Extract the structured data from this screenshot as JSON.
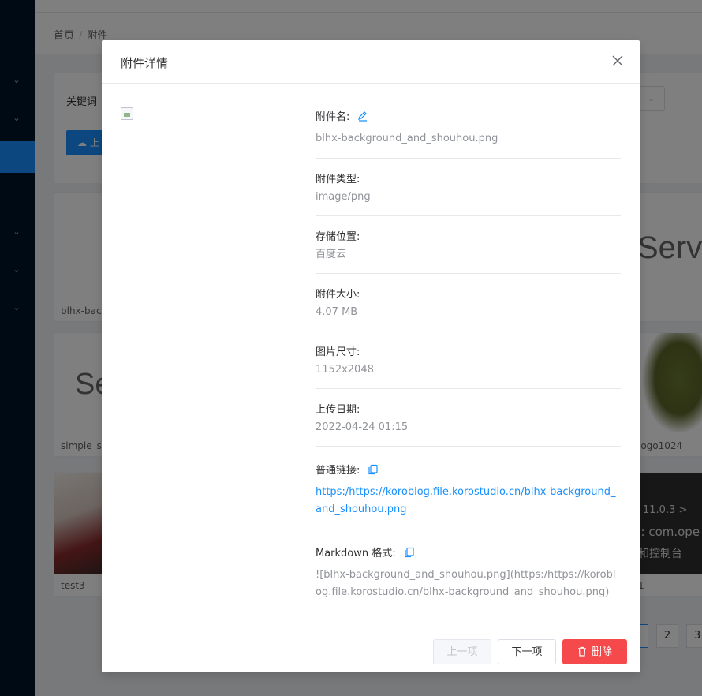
{
  "breadcrumb": {
    "home": "首页",
    "separator": "/",
    "current": "附件"
  },
  "filter": {
    "keyword_label": "关键词",
    "upload_label": "上"
  },
  "cards": [
    {
      "name": "blhx-bac"
    },
    {
      "name": "simple_s",
      "preview_text": "Se"
    },
    {
      "name": "test3"
    },
    {
      "name": "logo1024"
    },
    {
      "name": "1"
    },
    {
      "preview_text": "Servic"
    },
    {
      "preview_text": "11.0.3 >"
    },
    {
      "preview_text": "n: com.ope"
    },
    {
      "preview_text": "和控制台"
    }
  ],
  "pagination": {
    "p2": "2",
    "p3": "3"
  },
  "modal": {
    "title": "附件详情",
    "fields": {
      "name": {
        "label": "附件名:",
        "value": "blhx-background_and_shouhou.png"
      },
      "type": {
        "label": "附件类型:",
        "value": "image/png"
      },
      "storage": {
        "label": "存储位置:",
        "value": "百度云"
      },
      "size": {
        "label": "附件大小:",
        "value": "4.07 MB"
      },
      "dimensions": {
        "label": "图片尺寸:",
        "value": "1152x2048"
      },
      "upload_date": {
        "label": "上传日期:",
        "value": "2022-04-24 01:15"
      },
      "normal_link": {
        "label": "普通链接:",
        "value": "https:/https://koroblog.file.korostudio.cn/blhx-background_and_shouhou.png"
      },
      "markdown": {
        "label": "Markdown 格式:",
        "value": "![blhx-background_and_shouhou.png](https:/https://koroblog.file.korostudio.cn/blhx-background_and_shouhou.png)"
      }
    },
    "buttons": {
      "prev": "上一项",
      "next": "下一项",
      "delete": "删除"
    }
  },
  "icons": {
    "edit": "edit-icon",
    "copy": "copy-icon",
    "delete": "trash-icon",
    "close": "close-icon"
  },
  "colors": {
    "primary": "#1890ff",
    "danger": "#f5494b",
    "sidebar": "#001529"
  }
}
